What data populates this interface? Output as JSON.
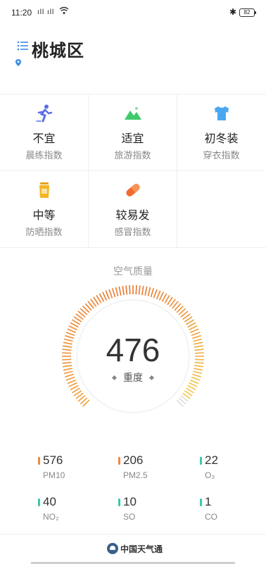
{
  "status_bar": {
    "time": "11:20",
    "signal": "ıll ıll",
    "battery": "82"
  },
  "header": {
    "title": "桃城区"
  },
  "indices": [
    {
      "value": "不宜",
      "label": "晨练指数",
      "icon": "running-icon",
      "color": "#5b6ee8"
    },
    {
      "value": "适宜",
      "label": "旅游指数",
      "icon": "mountain-icon",
      "color": "#3fc96a"
    },
    {
      "value": "初冬装",
      "label": "穿衣指数",
      "icon": "shirt-icon",
      "color": "#4aa8f0"
    },
    {
      "value": "中等",
      "label": "防晒指数",
      "icon": "sunscreen-icon",
      "color": "#f3b524"
    },
    {
      "value": "较易发",
      "label": "感冒指数",
      "icon": "pill-icon",
      "color": "#f26a2e"
    }
  ],
  "air_quality": {
    "label": "空气质量",
    "value": "476",
    "level": "重度",
    "gauge_colors": [
      "#e9742c",
      "#f0a13a",
      "#f5cf4a"
    ]
  },
  "pollutants": [
    {
      "value": "576",
      "name": "PM10",
      "color": "#f08a3a"
    },
    {
      "value": "206",
      "name": "PM2.5",
      "color": "#f08a3a"
    },
    {
      "value": "22",
      "name": "O₃",
      "color": "#3cc9b0"
    },
    {
      "value": "40",
      "name": "NO₂",
      "color": "#3cc9b0"
    },
    {
      "value": "10",
      "name": "SO",
      "color": "#3cc9b0"
    },
    {
      "value": "1",
      "name": "CO",
      "color": "#3cc9b0"
    }
  ],
  "footer": {
    "brand": "中国天气通"
  }
}
